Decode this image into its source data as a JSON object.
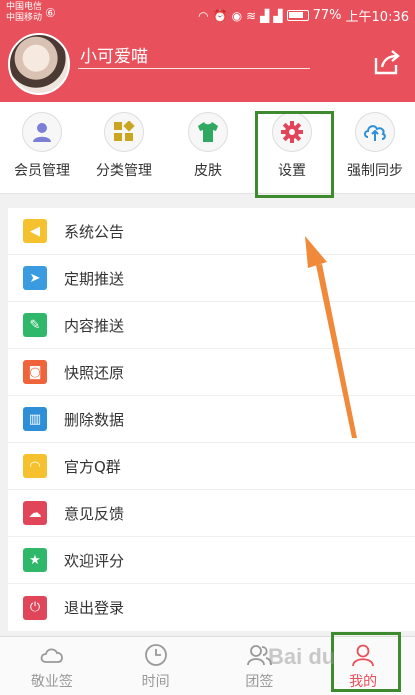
{
  "status_bar": {
    "carrier_1": "中国电信",
    "carrier_2": "中国移动",
    "battery": "77%",
    "time": "上午10:36"
  },
  "header": {
    "username": "小可爱喵",
    "bg_color": "#e8505b"
  },
  "quick_actions": [
    {
      "label": "会员管理",
      "icon": "user-icon"
    },
    {
      "label": "分类管理",
      "icon": "category-icon"
    },
    {
      "label": "皮肤",
      "icon": "tshirt-icon"
    },
    {
      "label": "设置",
      "icon": "gear-icon"
    },
    {
      "label": "强制同步",
      "icon": "sync-icon"
    }
  ],
  "menu": [
    {
      "label": "系统公告",
      "icon": "speaker-icon",
      "color": "#f5c12e"
    },
    {
      "label": "定期推送",
      "icon": "paper-plane-icon",
      "color": "#3a9be0"
    },
    {
      "label": "内容推送",
      "icon": "edit-icon",
      "color": "#2fb86a"
    },
    {
      "label": "快照还原",
      "icon": "camera-icon",
      "color": "#f0643c"
    },
    {
      "label": "删除数据",
      "icon": "trash-icon",
      "color": "#2e8fd8"
    },
    {
      "label": "官方Q群",
      "icon": "headset-icon",
      "color": "#f5c12e"
    },
    {
      "label": "意见反馈",
      "icon": "chat-icon",
      "color": "#e0455a"
    },
    {
      "label": "欢迎评分",
      "icon": "star-icon",
      "color": "#2fb86a"
    },
    {
      "label": "退出登录",
      "icon": "power-icon",
      "color": "#e0455a"
    }
  ],
  "bottom_nav": [
    {
      "label": "敬业签",
      "icon": "cloud-icon",
      "active": false
    },
    {
      "label": "时间",
      "icon": "clock-icon",
      "active": false
    },
    {
      "label": "团签",
      "icon": "group-icon",
      "active": false
    },
    {
      "label": "我的",
      "icon": "person-icon",
      "active": true
    }
  ],
  "watermark": "Bai du"
}
